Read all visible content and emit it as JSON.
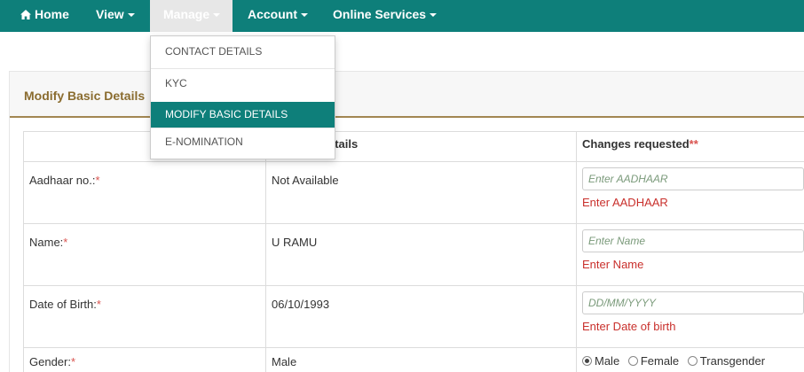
{
  "nav": {
    "home": "Home",
    "view": "View",
    "manage": "Manage",
    "account": "Account",
    "online_services": "Online Services"
  },
  "dropdown": {
    "items": [
      "CONTACT DETAILS",
      "KYC",
      "MODIFY BASIC DETAILS",
      "E-NOMINATION"
    ],
    "active": "MODIFY BASIC DETAILS"
  },
  "panel": {
    "title": "Modify Basic Details"
  },
  "table": {
    "headers": [
      "",
      "etails",
      "Changes requested"
    ],
    "header_required_mark": "**",
    "required_mark": "*",
    "rows": [
      {
        "label": "Aadhaar no.:",
        "current": "Not Available",
        "placeholder": "Enter AADHAAR",
        "error": "Enter AADHAAR"
      },
      {
        "label": "Name:",
        "current": "U RAMU",
        "placeholder": "Enter Name",
        "error": "Enter Name"
      },
      {
        "label": "Date of Birth:",
        "current": "06/10/1993",
        "placeholder": "DD/MM/YYYY",
        "error": "Enter Date of birth"
      },
      {
        "label": "Gender:",
        "current": "Male",
        "options": [
          "Male",
          "Female",
          "Transgender"
        ],
        "selected": "Male"
      }
    ]
  },
  "colors": {
    "navbar": "#0e7f7a",
    "accent_gold": "#a28752",
    "title_text": "#8a6c2f",
    "error": "#c9302c"
  }
}
